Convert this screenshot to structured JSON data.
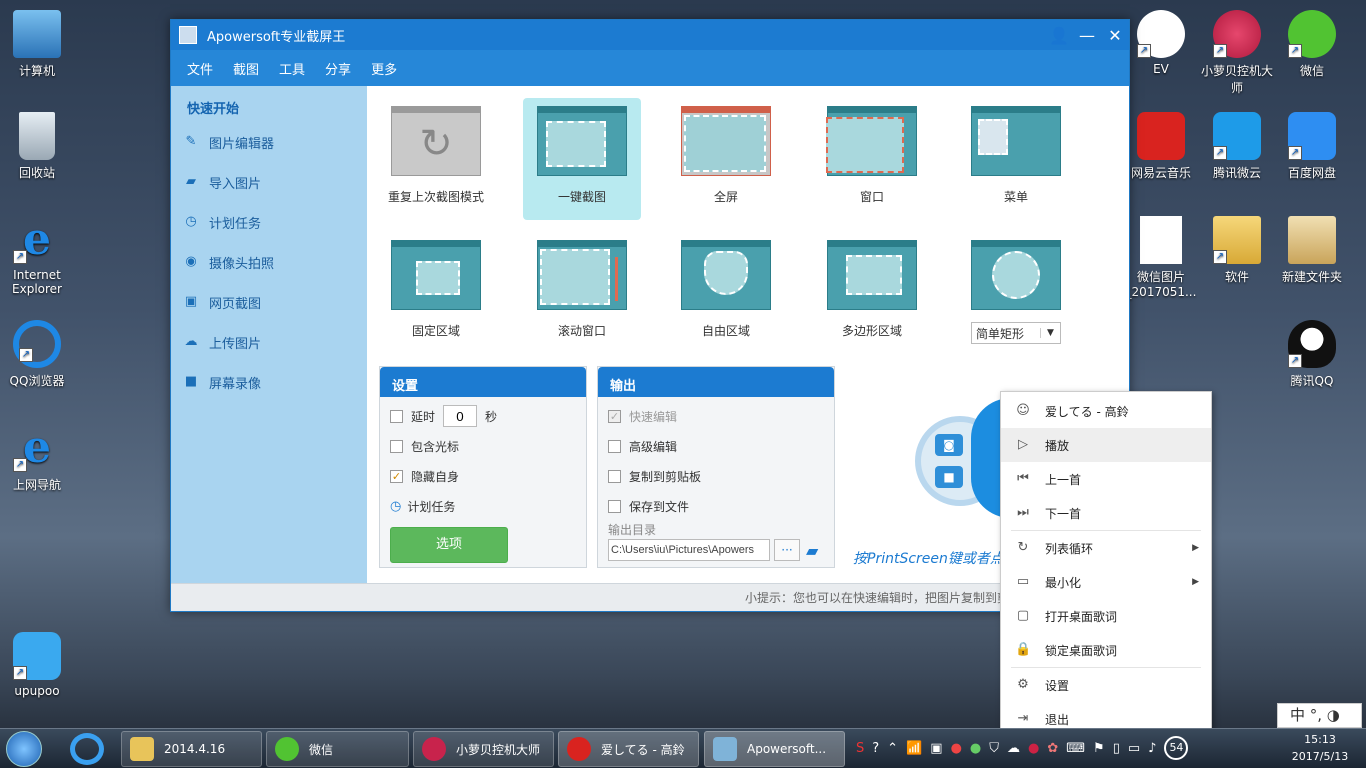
{
  "desktop_left": [
    {
      "label": "计算机"
    },
    {
      "label": "回收站"
    },
    {
      "label": "Internet Explorer"
    },
    {
      "label": "QQ浏览器"
    },
    {
      "label": "上网导航"
    },
    {
      "label": "upupoo"
    }
  ],
  "desktop_right": [
    {
      "label": "EV"
    },
    {
      "label": "小萝贝控机大师"
    },
    {
      "label": "微信"
    },
    {
      "label": "网易云音乐"
    },
    {
      "label": "腾讯微云"
    },
    {
      "label": "百度网盘"
    },
    {
      "label": "微信图片_2017051..."
    },
    {
      "label": "软件"
    },
    {
      "label": "新建文件夹"
    },
    {
      "label": "腾讯QQ"
    }
  ],
  "window": {
    "title": "Apowersoft专业截屏王"
  },
  "menu": [
    "文件",
    "截图",
    "工具",
    "分享",
    "更多"
  ],
  "sidebar": {
    "header": "快速开始",
    "items": [
      "图片编辑器",
      "导入图片",
      "计划任务",
      "摄像头拍照",
      "网页截图",
      "上传图片",
      "屏幕录像"
    ]
  },
  "tiles": [
    "重复上次截图模式",
    "一键截图",
    "全屏",
    "窗口",
    "菜单",
    "固定区域",
    "滚动窗口",
    "自由区域",
    "多边形区域"
  ],
  "shape_select": {
    "value": "简单矩形"
  },
  "settings": {
    "title": "设置",
    "delay_label": "延时",
    "delay_value": "0",
    "delay_unit": "秒",
    "include_cursor": "包含光标",
    "hide_self": "隐藏自身",
    "schedule": "计划任务",
    "options_button": "选项"
  },
  "output": {
    "title": "输出",
    "quick_edit": "快速编辑",
    "advanced_edit": "高级编辑",
    "copy_clipboard": "复制到剪贴板",
    "save_file": "保存到文件",
    "dir_label": "输出目录",
    "dir_value": "C:\\Users\\iu\\Pictures\\Apowers",
    "browse": "···"
  },
  "hint": "按PrintScreen键或者点",
  "footer": "小提示：您也可以在快速编辑时，把图片复制到剪",
  "context_menu": [
    "爱してる - 高鈴",
    "播放",
    "上一首",
    "下一首",
    "列表循环",
    "最小化",
    "打开桌面歌词",
    "锁定桌面歌词",
    "设置",
    "退出"
  ],
  "taskbar": [
    {
      "label": "2014.4.16"
    },
    {
      "label": "微信"
    },
    {
      "label": "小萝贝控机大师"
    },
    {
      "label": "爱してる - 高鈴"
    },
    {
      "label": "Apowersoft..."
    }
  ],
  "tray": {
    "number": "54"
  },
  "clock": {
    "time": "15:13",
    "date": "2017/5/13"
  },
  "ime": "中 °, ◑"
}
